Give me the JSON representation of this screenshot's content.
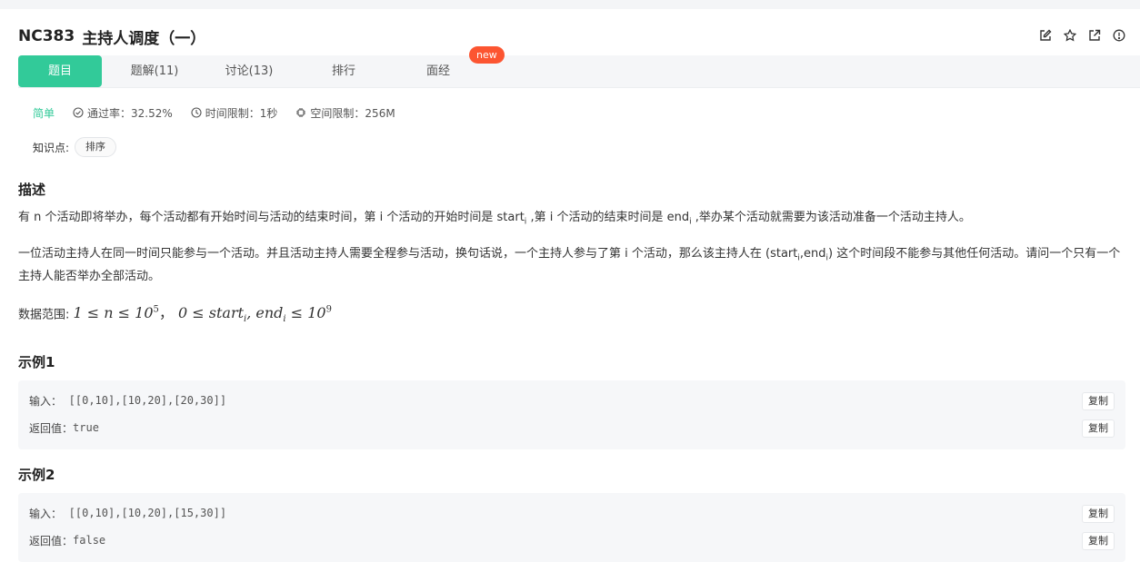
{
  "problem": {
    "id": "NC383",
    "title": "主持人调度（一）"
  },
  "header_icons": [
    "edit-icon",
    "star-icon",
    "external-link-icon",
    "info-icon"
  ],
  "tabs": [
    {
      "label": "题目",
      "active": true
    },
    {
      "label": "题解(11)",
      "active": false
    },
    {
      "label": "讨论(13)",
      "active": false
    },
    {
      "label": "排行",
      "active": false
    },
    {
      "label": "面经",
      "active": false
    }
  ],
  "new_badge": "new",
  "meta": {
    "difficulty": "简单",
    "pass_rate": "通过率：32.52%",
    "time_limit": "时间限制：1秒",
    "space_limit": "空间限制：256M"
  },
  "knowledge": {
    "label": "知识点:",
    "tags": [
      "排序"
    ]
  },
  "description": {
    "heading": "描述",
    "p1_a": "有 n 个活动即将举办，每个活动都有开始时间与活动的结束时间，第 i 个活动的开始时间是 start",
    "p1_sub1": "i",
    "p1_b": " ,第 i 个活动的结束时间是 end",
    "p1_sub2": "i",
    "p1_c": " ,举办某个活动就需要为该活动准备一个活动主持人。",
    "p2_a": "一位活动主持人在同一时间只能参与一个活动。并且活动主持人需要全程参与活动，换句话说，一个主持人参与了第 i 个活动，那么该主持人在 (start",
    "p2_sub1": "i",
    "p2_b": ",end",
    "p2_sub2": "i",
    "p2_c": ") 这个时间段不能参与其他任何活动。请问一个只有一个主持人能否举办全部活动。",
    "range_label": "数据范围:",
    "range_math1": "1 ≤ n ≤ 10",
    "range_sup1": "5",
    "range_sep": "，",
    "range_math2": "0 ≤ start",
    "range_sub_a": "i",
    "range_math3": ", end",
    "range_sub_b": "i",
    "range_math4": " ≤ 10",
    "range_sup2": "9"
  },
  "examples": [
    {
      "heading": "示例1",
      "input_label": "输入：",
      "input": "[[0,10],[10,20],[20,30]]",
      "output_label": "返回值：",
      "output": "true",
      "copy_label": "复制"
    },
    {
      "heading": "示例2",
      "input_label": "输入：",
      "input": "[[0,10],[10,20],[15,30]]",
      "output_label": "返回值：",
      "output": "false",
      "copy_label": "复制"
    }
  ]
}
